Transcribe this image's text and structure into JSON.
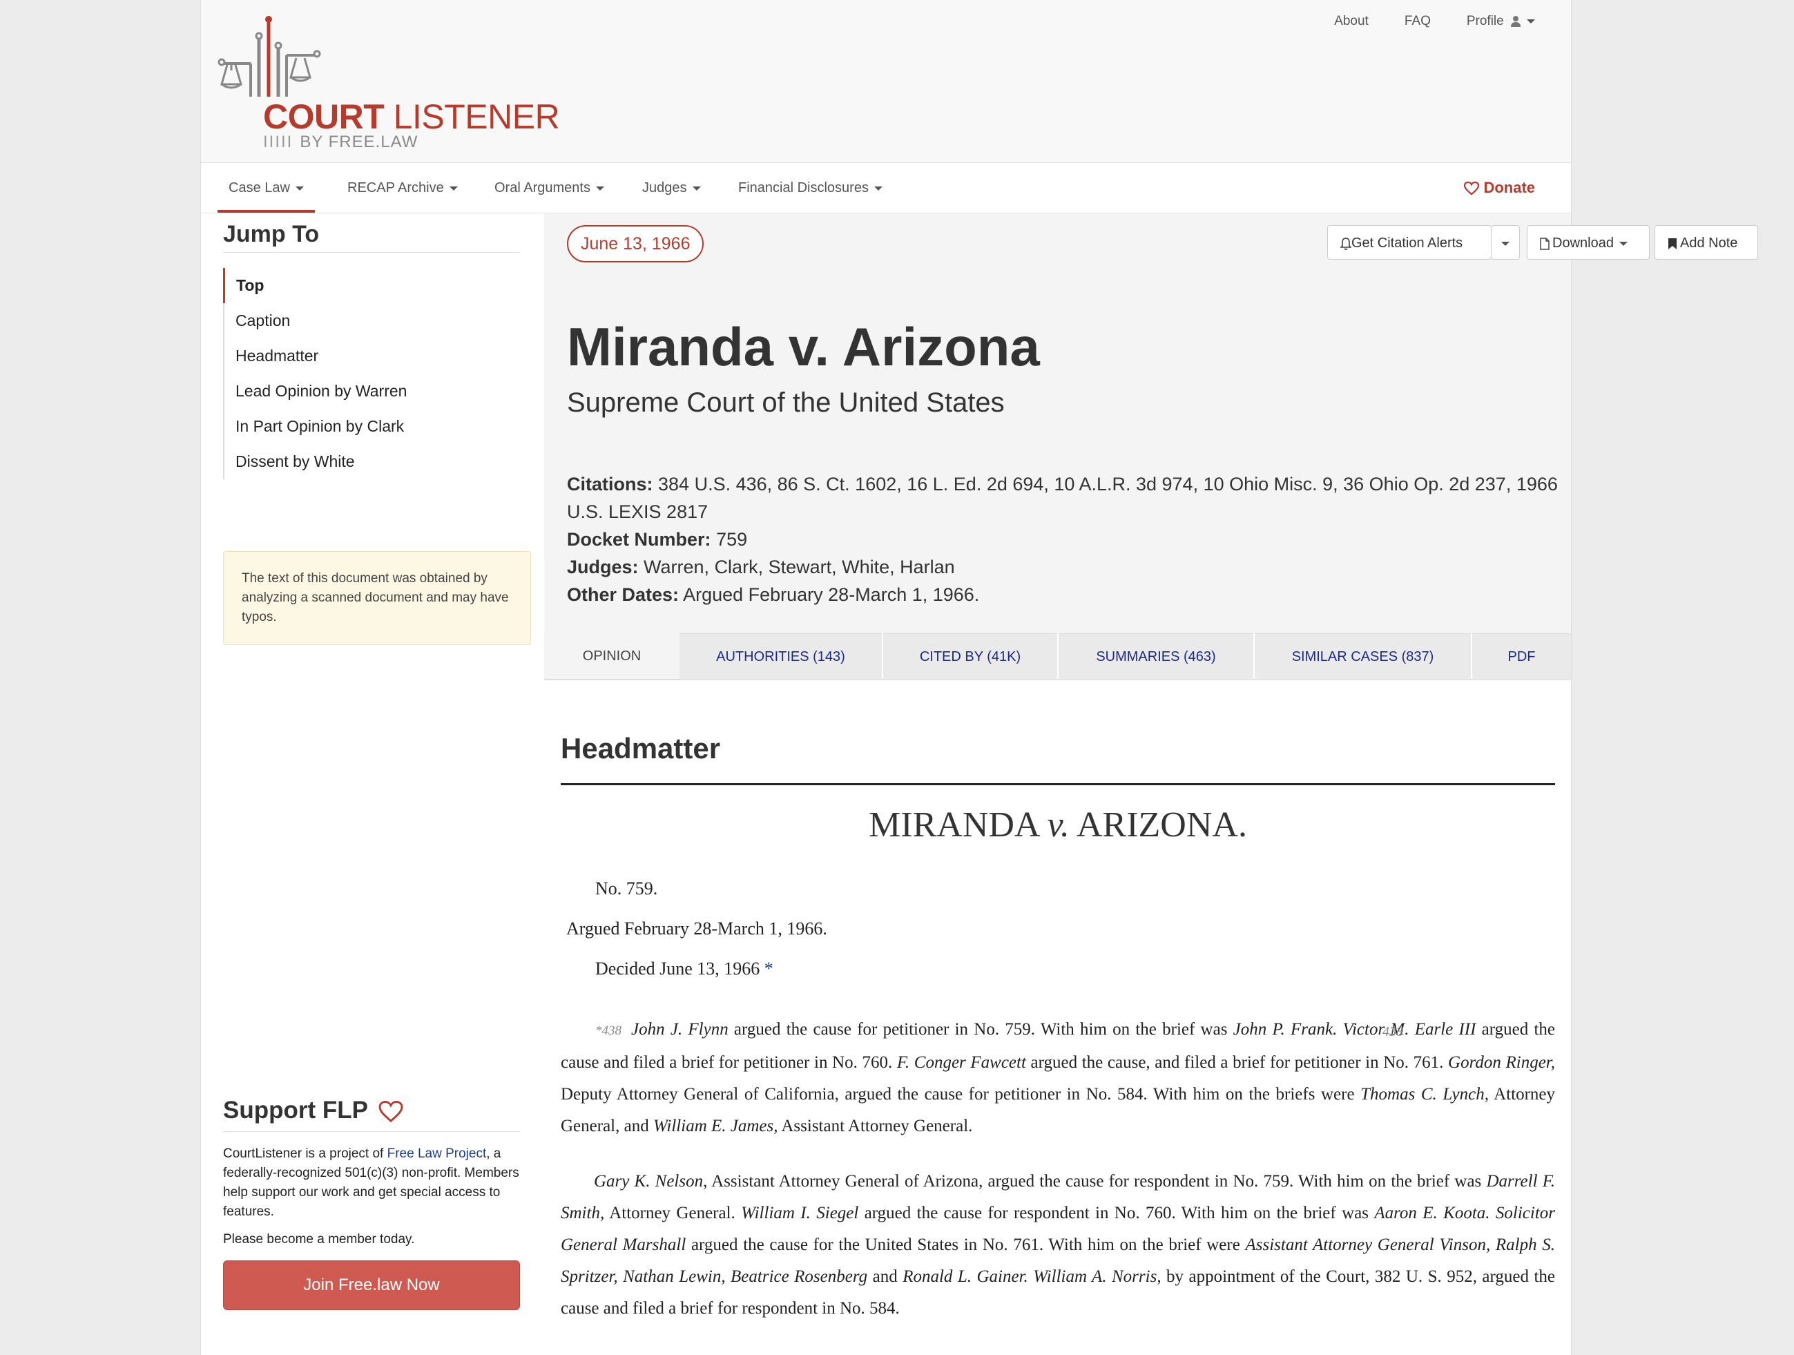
{
  "header": {
    "logo": {
      "word_bold": "COURT",
      "word_light": "LISTENER",
      "sub_bars": "IIIII",
      "sub": "BY FREE.LAW"
    },
    "links": [
      "About",
      "FAQ",
      "Profile"
    ],
    "profile_icon": "user-icon"
  },
  "nav": {
    "items": [
      "Case Law",
      "RECAP Archive",
      "Oral Arguments",
      "Judges",
      "Financial Disclosures"
    ],
    "donate": "Donate"
  },
  "sidebar": {
    "jump_title": "Jump To",
    "items": [
      "Top",
      "Caption",
      "Headmatter",
      "Lead Opinion by Warren",
      "In Part Opinion by Clark",
      "Dissent by White"
    ],
    "notice": "The text of this document was obtained by analyzing a scanned document and may have typos.",
    "support_title": "Support FLP",
    "support_text_1": "CourtListener is a project of ",
    "support_link": "Free Law Project",
    "support_text_2": ", a federally-recognized 501(c)(3) non-profit. Members help support our work and get special access to features.",
    "support_text_3": "Please become a member today.",
    "join_button": "Join Free.law Now"
  },
  "case": {
    "date": "June 13, 1966",
    "buttons": {
      "alerts": "Get Citation Alerts",
      "download": "Download",
      "note": "Add Note"
    },
    "title": "Miranda v. Arizona",
    "court": "Supreme Court of the United States",
    "citations_label": "Citations:",
    "citations": "384 U.S. 436, 86 S. Ct. 1602, 16 L. Ed. 2d 694, 10 A.L.R. 3d 974, 10 Ohio Misc. 9, 36 Ohio Op. 2d 237, 1966 U.S. LEXIS 2817",
    "docket_label": "Docket Number:",
    "docket": "759",
    "judges_label": "Judges:",
    "judges": "Warren, Clark, Stewart, White, Harlan",
    "other_dates_label": "Other Dates:",
    "other_dates": "Argued February 28-March 1, 1966."
  },
  "tabs": [
    "OPINION",
    "AUTHORITIES (143)",
    "CITED BY (41K)",
    "SUMMARIES (463)",
    "SIMILAR CASES (837)",
    "PDF"
  ],
  "opinion": {
    "heading": "Headmatter",
    "caption_a": "MIRANDA",
    "caption_v": "v.",
    "caption_b": "ARIZONA.",
    "no": "No. 759.",
    "argued": "Argued February 28-March 1, 1966.",
    "decided": "Decided June 13, 1966",
    "decided_star": "*",
    "page_marker": "*438",
    "margin_page": "438"
  },
  "colors": {
    "brand": "#b53b2c",
    "link": "#1b2a8a",
    "join_button": "#cf5a52"
  }
}
